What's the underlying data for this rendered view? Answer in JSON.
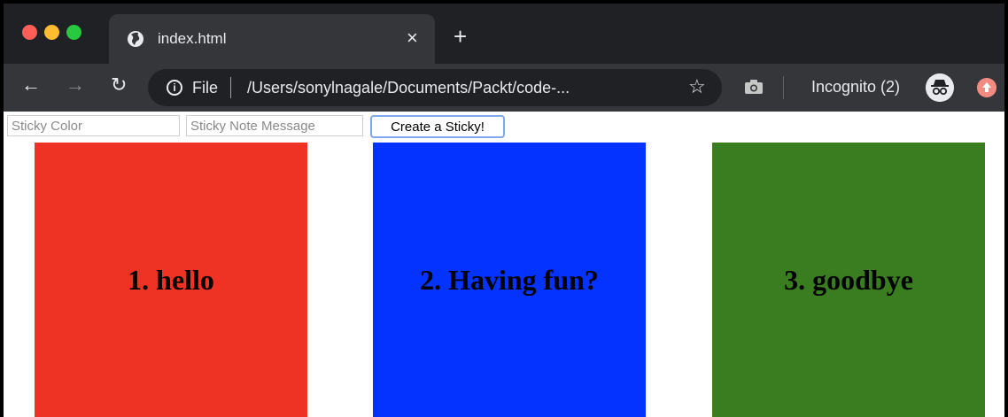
{
  "browser": {
    "tab": {
      "title": "index.html",
      "icon": "globe-icon"
    },
    "new_tab_label": "+",
    "address": {
      "scheme_label": "File",
      "url": "/Users/sonylnagale/Documents/Packt/code-..."
    },
    "incognito_label": "Incognito (2)"
  },
  "form": {
    "color_placeholder": "Sticky Color",
    "message_placeholder": "Sticky Note Message",
    "create_label": "Create a Sticky!"
  },
  "stickies": [
    {
      "text": "1. hello",
      "color": "#ee3224"
    },
    {
      "text": "2. Having fun?",
      "color": "#0433ff"
    },
    {
      "text": "3. goodbye",
      "color": "#397d20"
    }
  ],
  "colors": {
    "window_dark": "#202124",
    "toolbar": "#35363a",
    "accent_focus": "#7fa9e8"
  }
}
